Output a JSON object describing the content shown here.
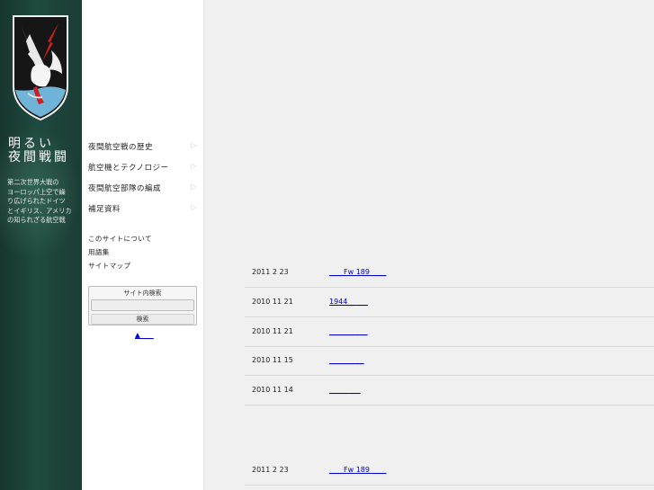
{
  "brand": {
    "title_line1": "明るい",
    "title_line2": "夜間戦闘",
    "tagline": [
      "第二次世界大戦の",
      "ヨーロッパ上空で繰",
      "り広げられたドイツ",
      "とイギリス、アメリカ",
      "の知られざる航空戦"
    ]
  },
  "nav": {
    "items": [
      {
        "label": "夜間航空戦の歴史"
      },
      {
        "label": "航空機とテクノロジー"
      },
      {
        "label": "夜間航空部隊の編成"
      },
      {
        "label": "補足資料"
      }
    ],
    "arrow": "▷",
    "sub_links": [
      {
        "label": "このサイトについて"
      },
      {
        "label": "用語集"
      },
      {
        "label": "サイトマップ"
      }
    ]
  },
  "search": {
    "label": "サイト内検索",
    "placeholder": "",
    "button_label": "検索"
  },
  "page_top": "▲____",
  "news_top": [
    {
      "date": "2011 2 23",
      "title": "____Fw 189 ____"
    },
    {
      "date": "2010 11 21",
      "title": "1944__ ___"
    },
    {
      "date": "2010 11 21",
      "title": "_______ ___"
    },
    {
      "date": "2010 11 15",
      "title": "_______ __"
    },
    {
      "date": "2010 11 14",
      "title": "_____ ___"
    }
  ],
  "news_bottom": [
    {
      "date": "2011 2 23",
      "title": "____Fw 189 ____"
    }
  ],
  "colors": {
    "sidebar_dark": "#1b3d35",
    "link": "#0000cc",
    "emblem_red": "#cc2020",
    "emblem_blue": "#6fb3d8"
  }
}
